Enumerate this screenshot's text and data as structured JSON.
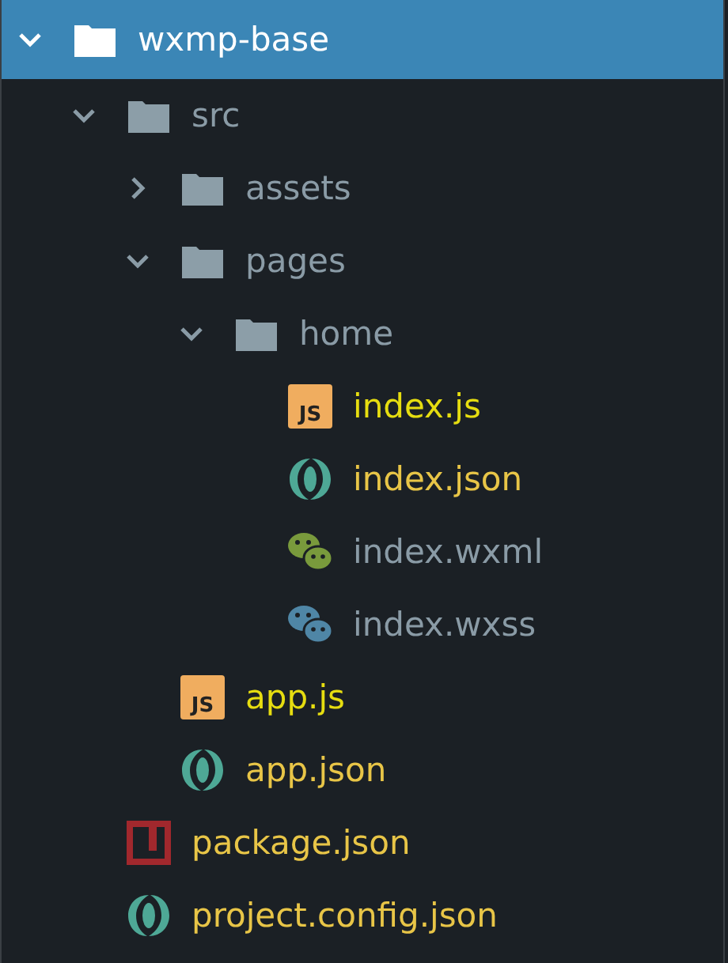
{
  "tree": [
    {
      "name": "wxmp-base",
      "kind": "folder",
      "expanded": true,
      "selected": true,
      "color": "#ffffff",
      "children": [
        {
          "name": "src",
          "kind": "folder",
          "expanded": true,
          "selected": false,
          "color": "#8a9ba6",
          "children": [
            {
              "name": "assets",
              "kind": "folder",
              "expanded": false,
              "selected": false,
              "color": "#8a9ba6"
            },
            {
              "name": "pages",
              "kind": "folder",
              "expanded": true,
              "selected": false,
              "color": "#8a9ba6",
              "children": [
                {
                  "name": "home",
                  "kind": "folder",
                  "expanded": true,
                  "selected": false,
                  "color": "#8a9ba6",
                  "children": [
                    {
                      "name": "index.js",
                      "kind": "js",
                      "badge": "JS",
                      "selected": false,
                      "color": "#e6dd10"
                    },
                    {
                      "name": "index.json",
                      "kind": "json",
                      "selected": false,
                      "color": "#e8c547"
                    },
                    {
                      "name": "index.wxml",
                      "kind": "wechat-green",
                      "selected": false,
                      "color": "#8a9ba6"
                    },
                    {
                      "name": "index.wxss",
                      "kind": "wechat-blue",
                      "selected": false,
                      "color": "#8a9ba6"
                    }
                  ]
                }
              ]
            },
            {
              "name": "app.js",
              "kind": "js",
              "badge": "JS",
              "selected": false,
              "color": "#e6dd10"
            },
            {
              "name": "app.json",
              "kind": "json",
              "selected": false,
              "color": "#e8c547"
            }
          ]
        },
        {
          "name": "package.json",
          "kind": "npm",
          "selected": false,
          "color": "#e8c547"
        },
        {
          "name": "project.config.json",
          "kind": "json",
          "selected": false,
          "color": "#e8c547"
        }
      ]
    }
  ]
}
